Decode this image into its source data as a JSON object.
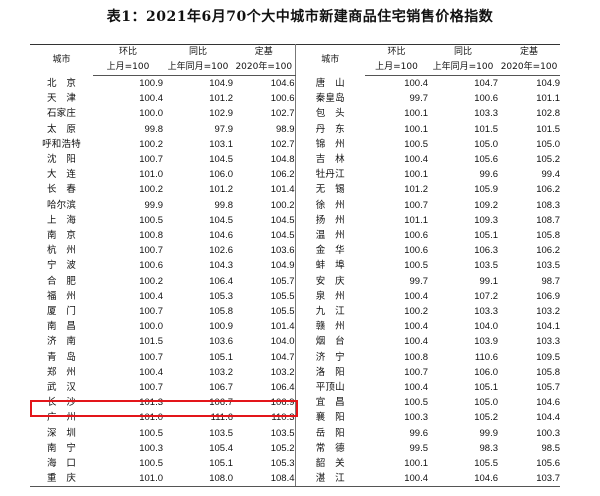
{
  "title": "表1：2021年6月70个大中城市新建商品住宅销售价格指数",
  "header": {
    "city": "城市",
    "mom": "环比",
    "yoy": "同比",
    "base": "定基",
    "mom_sub": "上月=100",
    "yoy_sub": "上年同月=100",
    "base_sub": "2020年=100"
  },
  "left": [
    {
      "city": "北　京",
      "mom": "100.9",
      "yoy": "104.9",
      "base": "104.6"
    },
    {
      "city": "天　津",
      "mom": "100.4",
      "yoy": "101.2",
      "base": "100.6"
    },
    {
      "city": "石家庄",
      "mom": "100.0",
      "yoy": "102.9",
      "base": "102.7"
    },
    {
      "city": "太　原",
      "mom": "99.8",
      "yoy": "97.9",
      "base": "98.9"
    },
    {
      "city": "呼和浩特",
      "mom": "100.2",
      "yoy": "103.1",
      "base": "102.7"
    },
    {
      "city": "沈　阳",
      "mom": "100.7",
      "yoy": "104.5",
      "base": "104.8"
    },
    {
      "city": "大　连",
      "mom": "101.0",
      "yoy": "106.0",
      "base": "106.2"
    },
    {
      "city": "长　春",
      "mom": "100.2",
      "yoy": "101.2",
      "base": "101.4"
    },
    {
      "city": "哈尔滨",
      "mom": "99.9",
      "yoy": "99.8",
      "base": "100.2"
    },
    {
      "city": "上　海",
      "mom": "100.5",
      "yoy": "104.5",
      "base": "104.5"
    },
    {
      "city": "南　京",
      "mom": "100.8",
      "yoy": "104.6",
      "base": "104.5"
    },
    {
      "city": "杭　州",
      "mom": "100.7",
      "yoy": "102.6",
      "base": "103.6"
    },
    {
      "city": "宁　波",
      "mom": "100.6",
      "yoy": "104.3",
      "base": "104.9"
    },
    {
      "city": "合　肥",
      "mom": "100.2",
      "yoy": "106.4",
      "base": "105.7"
    },
    {
      "city": "福　州",
      "mom": "100.4",
      "yoy": "105.3",
      "base": "105.5"
    },
    {
      "city": "厦　门",
      "mom": "100.7",
      "yoy": "105.8",
      "base": "105.5"
    },
    {
      "city": "南　昌",
      "mom": "100.0",
      "yoy": "100.9",
      "base": "101.4"
    },
    {
      "city": "济　南",
      "mom": "101.5",
      "yoy": "103.6",
      "base": "104.0"
    },
    {
      "city": "青　岛",
      "mom": "100.7",
      "yoy": "105.1",
      "base": "104.7"
    },
    {
      "city": "郑　州",
      "mom": "100.4",
      "yoy": "103.2",
      "base": "103.2"
    },
    {
      "city": "武　汉",
      "mom": "100.7",
      "yoy": "106.7",
      "base": "106.4"
    },
    {
      "city": "长　沙",
      "mom": "101.3",
      "yoy": "106.7",
      "base": "106.9"
    },
    {
      "city": "广　州",
      "mom": "101.0",
      "yoy": "111.6",
      "base": "110.3"
    },
    {
      "city": "深　圳",
      "mom": "100.5",
      "yoy": "103.5",
      "base": "103.5"
    },
    {
      "city": "南　宁",
      "mom": "100.3",
      "yoy": "105.4",
      "base": "105.2"
    },
    {
      "city": "海　口",
      "mom": "100.5",
      "yoy": "105.1",
      "base": "105.3"
    },
    {
      "city": "重　庆",
      "mom": "101.0",
      "yoy": "108.0",
      "base": "108.4"
    }
  ],
  "right": [
    {
      "city": "唐　山",
      "mom": "100.4",
      "yoy": "104.7",
      "base": "104.9"
    },
    {
      "city": "秦皇岛",
      "mom": "99.7",
      "yoy": "100.6",
      "base": "101.1"
    },
    {
      "city": "包　头",
      "mom": "100.1",
      "yoy": "103.3",
      "base": "102.8"
    },
    {
      "city": "丹　东",
      "mom": "100.1",
      "yoy": "101.5",
      "base": "101.5"
    },
    {
      "city": "锦　州",
      "mom": "100.5",
      "yoy": "105.0",
      "base": "105.0"
    },
    {
      "city": "吉　林",
      "mom": "100.4",
      "yoy": "105.6",
      "base": "105.2"
    },
    {
      "city": "牡丹江",
      "mom": "100.1",
      "yoy": "99.6",
      "base": "99.4"
    },
    {
      "city": "无　锡",
      "mom": "101.2",
      "yoy": "105.9",
      "base": "106.2"
    },
    {
      "city": "徐　州",
      "mom": "100.7",
      "yoy": "109.2",
      "base": "108.3"
    },
    {
      "city": "扬　州",
      "mom": "101.1",
      "yoy": "109.3",
      "base": "108.7"
    },
    {
      "city": "温　州",
      "mom": "100.6",
      "yoy": "105.1",
      "base": "105.8"
    },
    {
      "city": "金　华",
      "mom": "100.6",
      "yoy": "106.3",
      "base": "106.2"
    },
    {
      "city": "蚌　埠",
      "mom": "100.5",
      "yoy": "103.5",
      "base": "103.5"
    },
    {
      "city": "安　庆",
      "mom": "99.7",
      "yoy": "99.1",
      "base": "98.7"
    },
    {
      "city": "泉　州",
      "mom": "100.4",
      "yoy": "107.2",
      "base": "106.9"
    },
    {
      "city": "九　江",
      "mom": "100.2",
      "yoy": "103.3",
      "base": "103.2"
    },
    {
      "city": "赣　州",
      "mom": "100.4",
      "yoy": "104.0",
      "base": "104.1"
    },
    {
      "city": "烟　台",
      "mom": "100.4",
      "yoy": "103.9",
      "base": "103.3"
    },
    {
      "city": "济　宁",
      "mom": "100.8",
      "yoy": "110.6",
      "base": "109.5"
    },
    {
      "city": "洛　阳",
      "mom": "100.7",
      "yoy": "106.0",
      "base": "105.8"
    },
    {
      "city": "平顶山",
      "mom": "100.4",
      "yoy": "105.1",
      "base": "105.7"
    },
    {
      "city": "宜　昌",
      "mom": "100.5",
      "yoy": "105.0",
      "base": "104.6"
    },
    {
      "city": "襄　阳",
      "mom": "100.3",
      "yoy": "105.2",
      "base": "104.4"
    },
    {
      "city": "岳　阳",
      "mom": "99.6",
      "yoy": "99.9",
      "base": "100.3"
    },
    {
      "city": "常　德",
      "mom": "99.5",
      "yoy": "98.3",
      "base": "98.5"
    },
    {
      "city": "韶　关",
      "mom": "100.1",
      "yoy": "105.5",
      "base": "105.6"
    },
    {
      "city": "湛　江",
      "mom": "100.4",
      "yoy": "104.6",
      "base": "103.7"
    }
  ],
  "highlight_color": "#e3151a"
}
